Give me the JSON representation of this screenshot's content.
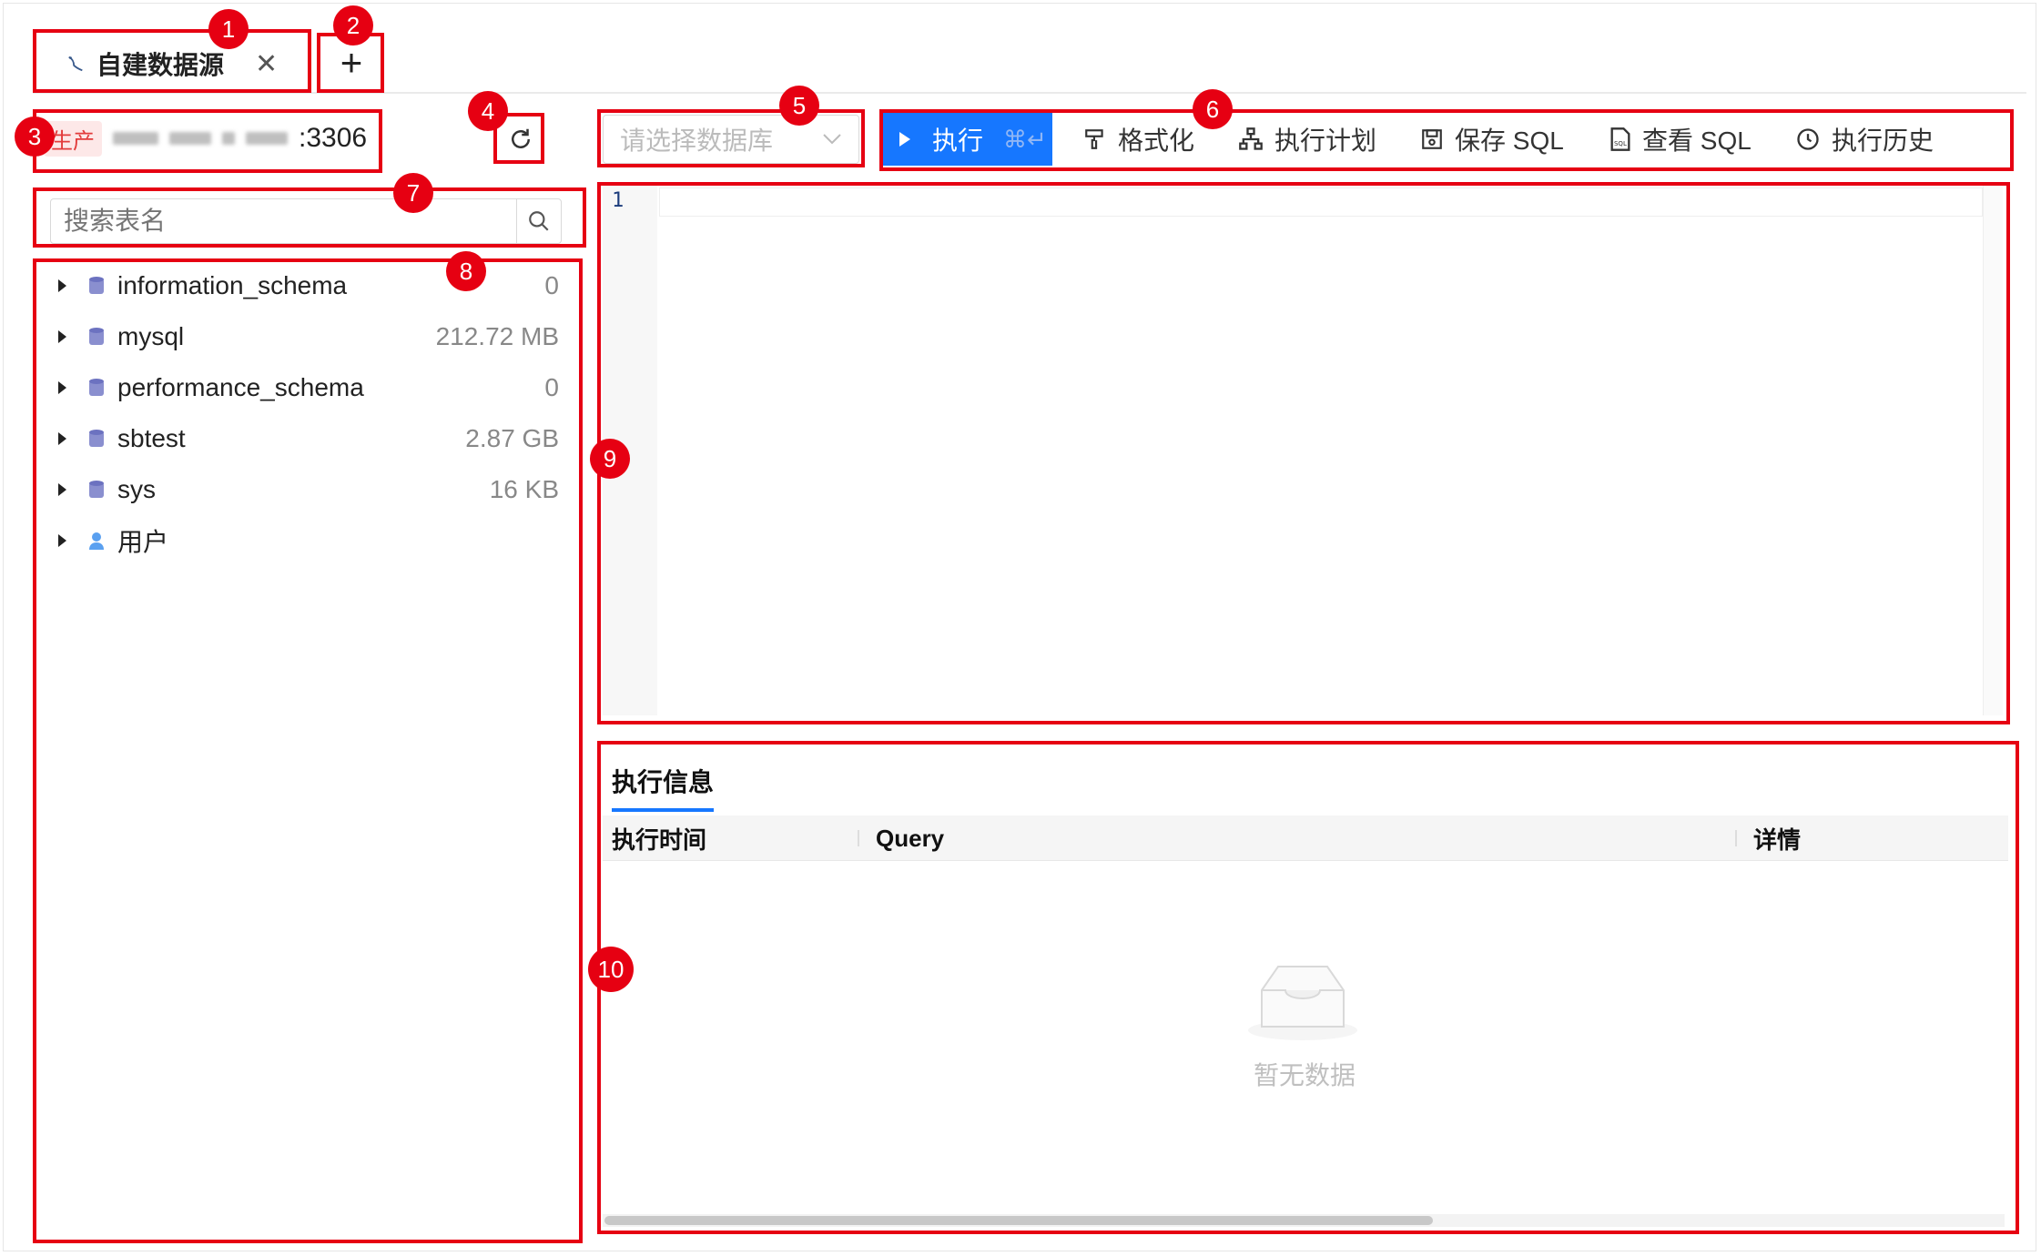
{
  "tabs": [
    {
      "label": "自建数据源"
    }
  ],
  "connection": {
    "env": "生产",
    "port": ":3306"
  },
  "search": {
    "placeholder": "搜索表名"
  },
  "tree": [
    {
      "name": "information_schema",
      "size": "0",
      "icon": "database-icon"
    },
    {
      "name": "mysql",
      "size": "212.72 MB",
      "icon": "database-icon"
    },
    {
      "name": "performance_schema",
      "size": "0",
      "icon": "database-icon"
    },
    {
      "name": "sbtest",
      "size": "2.87 GB",
      "icon": "database-icon"
    },
    {
      "name": "sys",
      "size": "16 KB",
      "icon": "database-icon"
    },
    {
      "name": "用户",
      "size": "",
      "icon": "user-icon"
    }
  ],
  "db_select": {
    "placeholder": "请选择数据库"
  },
  "toolbar": {
    "run": "执行",
    "run_shortcut": "⌘↵",
    "format": "格式化",
    "plan": "执行计划",
    "save": "保存 SQL",
    "view": "查看 SQL",
    "history": "执行历史"
  },
  "editor": {
    "line_number": "1"
  },
  "results": {
    "title": "执行信息",
    "columns": [
      "执行时间",
      "Query",
      "详情"
    ],
    "empty": "暂无数据"
  },
  "annotations": [
    "1",
    "2",
    "3",
    "4",
    "5",
    "6",
    "7",
    "8",
    "9",
    "10"
  ],
  "colors": {
    "accent": "#1677ff",
    "annotation": "#e60012",
    "env_tag_bg": "#fde8e8"
  }
}
